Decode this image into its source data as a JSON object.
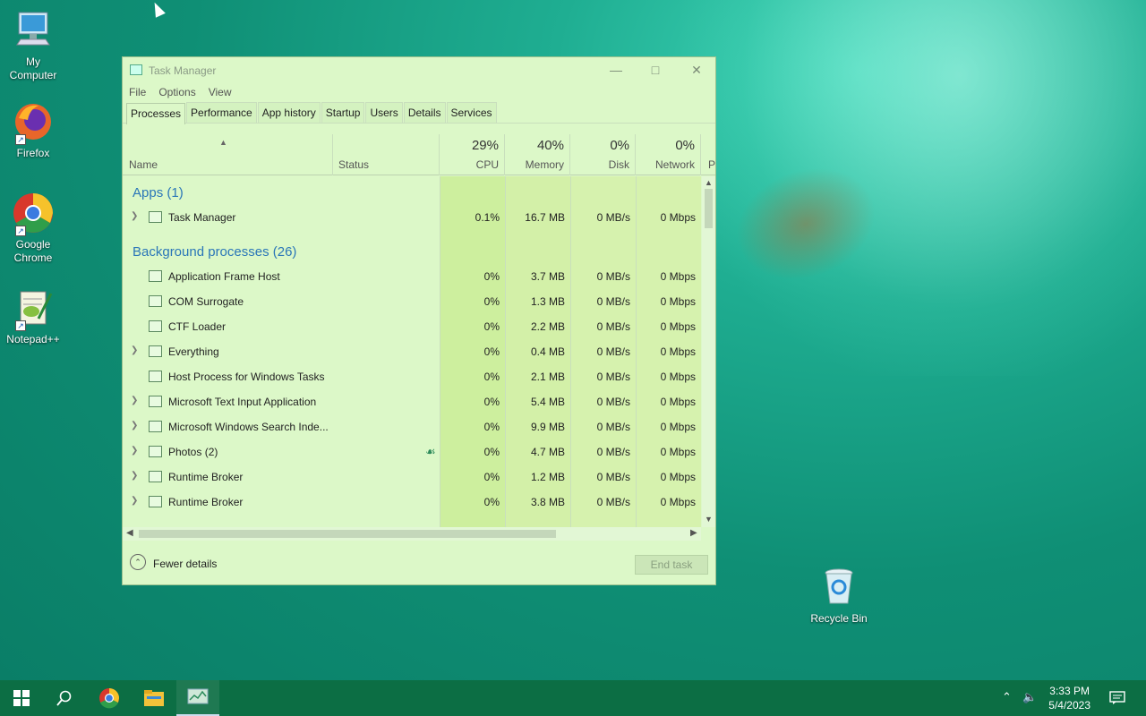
{
  "desktop": {
    "icons": [
      {
        "label": "My\nComputer",
        "icon": "computer-icon"
      },
      {
        "label": "Firefox",
        "icon": "firefox-icon"
      },
      {
        "label": "Google\nChrome",
        "icon": "chrome-icon"
      },
      {
        "label": "Notepad++",
        "icon": "notepadpp-icon"
      },
      {
        "label": "Recycle Bin",
        "icon": "recycle-bin-icon"
      }
    ]
  },
  "window": {
    "title": "Task Manager",
    "menu": [
      "File",
      "Options",
      "View"
    ],
    "tabs": [
      "Processes",
      "Performance",
      "App history",
      "Startup",
      "Users",
      "Details",
      "Services"
    ],
    "active_tab": "Processes",
    "columns": {
      "name": "Name",
      "status": "Status",
      "cpu": {
        "pct": "29%",
        "label": "CPU"
      },
      "memory": {
        "pct": "40%",
        "label": "Memory"
      },
      "disk": {
        "pct": "0%",
        "label": "Disk"
      },
      "network": {
        "pct": "0%",
        "label": "Network"
      },
      "power": "P"
    },
    "groups": {
      "apps": "Apps (1)",
      "background": "Background processes (26)"
    },
    "rows": [
      {
        "name": "Task Manager",
        "cpu": "0.1%",
        "memory": "16.7 MB",
        "disk": "0 MB/s",
        "network": "0 Mbps",
        "expandable": true
      },
      {
        "name": "Application Frame Host",
        "cpu": "0%",
        "memory": "3.7 MB",
        "disk": "0 MB/s",
        "network": "0 Mbps",
        "expandable": false
      },
      {
        "name": "COM Surrogate",
        "cpu": "0%",
        "memory": "1.3 MB",
        "disk": "0 MB/s",
        "network": "0 Mbps",
        "expandable": false
      },
      {
        "name": "CTF Loader",
        "cpu": "0%",
        "memory": "2.2 MB",
        "disk": "0 MB/s",
        "network": "0 Mbps",
        "expandable": false
      },
      {
        "name": "Everything",
        "cpu": "0%",
        "memory": "0.4 MB",
        "disk": "0 MB/s",
        "network": "0 Mbps",
        "expandable": true
      },
      {
        "name": "Host Process for Windows Tasks",
        "cpu": "0%",
        "memory": "2.1 MB",
        "disk": "0 MB/s",
        "network": "0 Mbps",
        "expandable": false
      },
      {
        "name": "Microsoft Text Input Application",
        "cpu": "0%",
        "memory": "5.4 MB",
        "disk": "0 MB/s",
        "network": "0 Mbps",
        "expandable": true
      },
      {
        "name": "Microsoft Windows Search Inde...",
        "cpu": "0%",
        "memory": "9.9 MB",
        "disk": "0 MB/s",
        "network": "0 Mbps",
        "expandable": true
      },
      {
        "name": "Photos (2)",
        "cpu": "0%",
        "memory": "4.7 MB",
        "disk": "0 MB/s",
        "network": "0 Mbps",
        "expandable": true
      },
      {
        "name": "Runtime Broker",
        "cpu": "0%",
        "memory": "1.2 MB",
        "disk": "0 MB/s",
        "network": "0 Mbps",
        "expandable": true
      },
      {
        "name": "Runtime Broker",
        "cpu": "0%",
        "memory": "3.8 MB",
        "disk": "0 MB/s",
        "network": "0 Mbps",
        "expandable": true
      }
    ],
    "footer": {
      "fewer_details": "Fewer details",
      "end_task": "End task"
    }
  },
  "taskbar": {
    "time": "3:33 PM",
    "date": "5/4/2023"
  },
  "colors": {
    "window_bg": "#dcf8c8",
    "taskbar": "#0c6e44",
    "group_text": "#2a76b8"
  }
}
